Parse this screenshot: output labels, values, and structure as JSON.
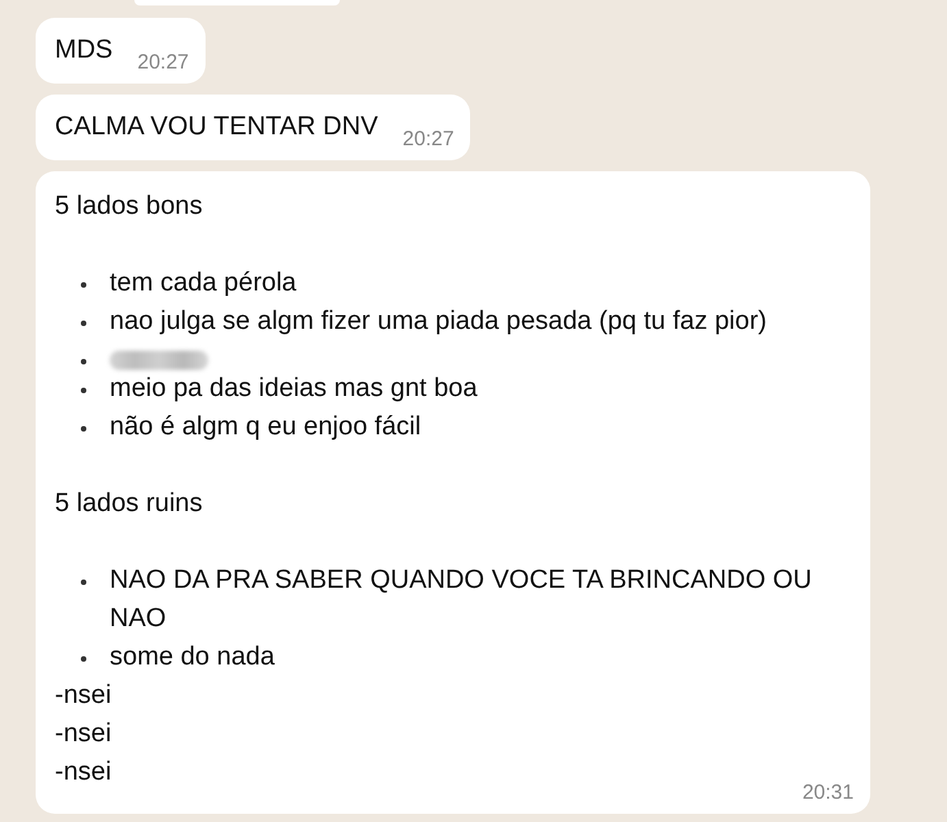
{
  "messages": [
    {
      "text": "MDS",
      "time": "20:27"
    },
    {
      "text": "CALMA VOU TENTAR DNV",
      "time": "20:27"
    }
  ],
  "long_message": {
    "time": "20:31",
    "lines": [
      {
        "kind": "text",
        "text": "5 lados bons"
      },
      {
        "kind": "blank"
      },
      {
        "kind": "bullet",
        "text": "tem cada pérola"
      },
      {
        "kind": "bullet",
        "text": "nao julga se algm fizer uma piada pesada (pq tu faz pior)"
      },
      {
        "kind": "redacted"
      },
      {
        "kind": "bullet",
        "text": "meio pa das ideias mas gnt boa"
      },
      {
        "kind": "bullet",
        "text": "não é algm q eu enjoo fácil"
      },
      {
        "kind": "blank"
      },
      {
        "kind": "text",
        "text": "5 lados ruins"
      },
      {
        "kind": "blank"
      },
      {
        "kind": "bullet",
        "text": "NAO DA PRA SABER QUANDO VOCE TA BRINCANDO OU NAO"
      },
      {
        "kind": "bullet",
        "text": "some do nada"
      },
      {
        "kind": "text",
        "text": "-nsei"
      },
      {
        "kind": "text",
        "text": "-nsei"
      },
      {
        "kind": "text",
        "text": "-nsei"
      }
    ]
  }
}
